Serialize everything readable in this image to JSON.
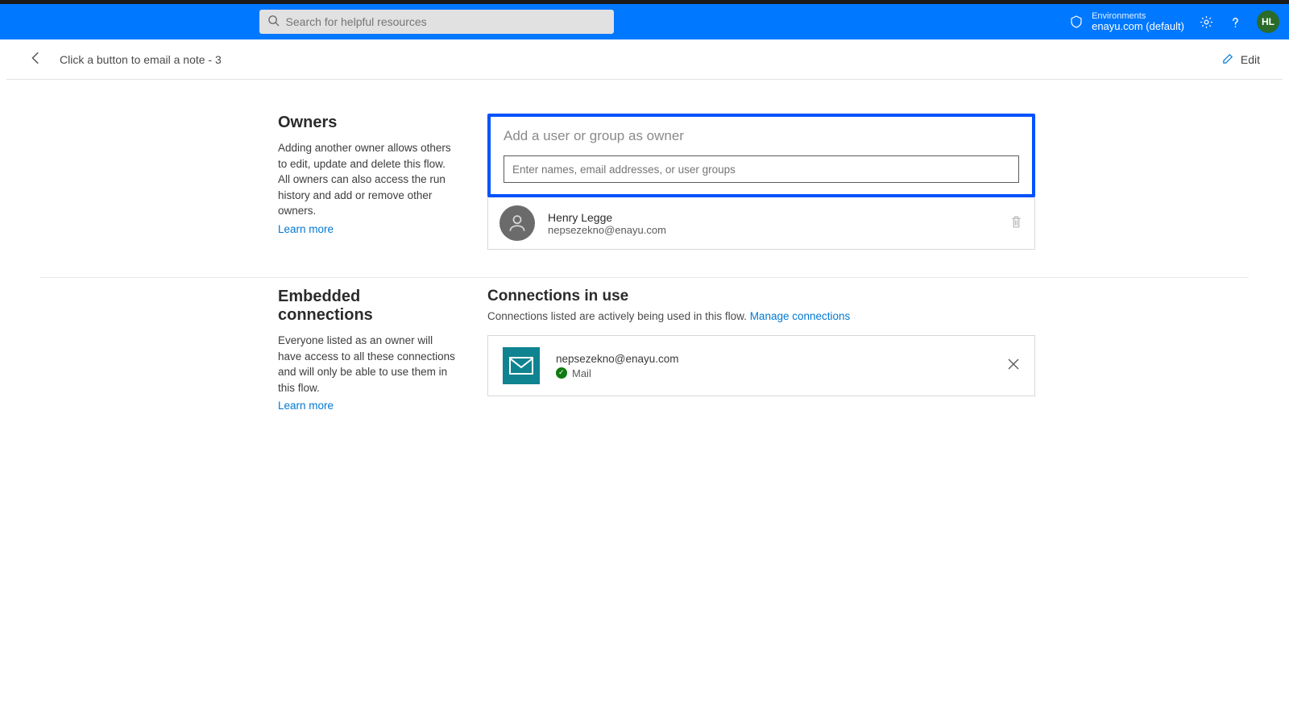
{
  "topbar": {
    "search_placeholder": "Search for helpful resources",
    "env_label": "Environments",
    "env_name": "enayu.com (default)",
    "avatar_initials": "HL"
  },
  "commandbar": {
    "title": "Click a button to email a note - 3",
    "edit_label": "Edit"
  },
  "owners_section": {
    "heading": "Owners",
    "description": "Adding another owner allows others to edit, update and delete this flow. All owners can also access the run history and add or remove other owners.",
    "learn_more": "Learn more",
    "add_owner_title": "Add a user or group as owner",
    "input_placeholder": "Enter names, email addresses, or user groups",
    "owners": [
      {
        "name": "Henry Legge",
        "email": "nepsezekno@enayu.com"
      }
    ]
  },
  "connections_section": {
    "heading_left": "Embedded connections",
    "description": "Everyone listed as an owner will have access to all these connections and will only be able to use them in this flow.",
    "learn_more": "Learn more",
    "heading_right": "Connections in use",
    "subtext": "Connections listed are actively being used in this flow. ",
    "manage_link": "Manage connections",
    "connections": [
      {
        "email": "nepsezekno@enayu.com",
        "service": "Mail"
      }
    ]
  }
}
